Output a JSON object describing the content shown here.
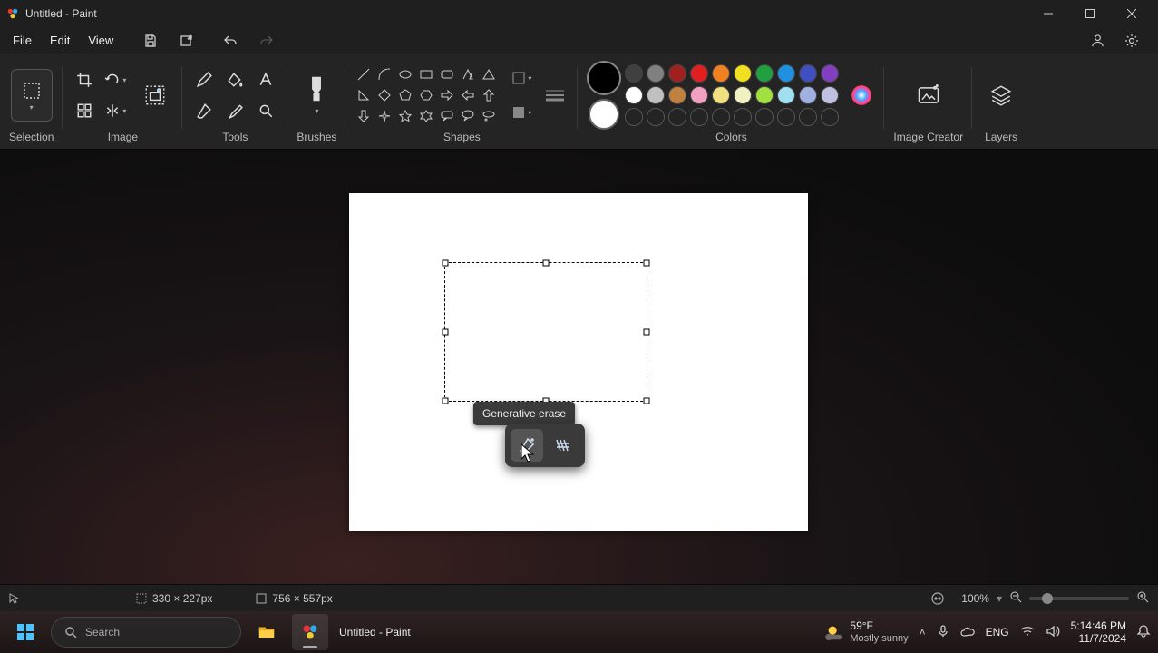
{
  "titlebar": {
    "title": "Untitled - Paint"
  },
  "menu": {
    "file": "File",
    "edit": "Edit",
    "view": "View"
  },
  "ribbon": {
    "selection": "Selection",
    "image": "Image",
    "tools": "Tools",
    "brushes": "Brushes",
    "shapes": "Shapes",
    "colors": "Colors",
    "image_creator": "Image Creator",
    "layers": "Layers"
  },
  "palette_row1": [
    "#000000",
    "#404040",
    "#808080",
    "#a02020",
    "#e02020",
    "#f08020",
    "#f0e020",
    "#20a040",
    "#2090e0",
    "#4050c0",
    "#8040c0"
  ],
  "palette_row2": [
    "#ffffff",
    "#c0c0c0",
    "#c08040",
    "#f0a0c0",
    "#f0e080",
    "#f0f0c0",
    "#a0e040",
    "#a0e0f0",
    "#a0b0e0",
    "#c0c0e0"
  ],
  "color1": "#000000",
  "color2": "#ffffff",
  "tooltip": {
    "generative_erase": "Generative erase"
  },
  "status": {
    "selection_size": "330 × 227px",
    "canvas_size": "756 × 557px",
    "zoom": "100%"
  },
  "taskbar": {
    "search_placeholder": "Search",
    "app_label": "Untitled - Paint",
    "weather_temp": "59°F",
    "weather_desc": "Mostly sunny",
    "lang": "ENG",
    "time": "5:14:46 PM",
    "date": "11/7/2024"
  }
}
